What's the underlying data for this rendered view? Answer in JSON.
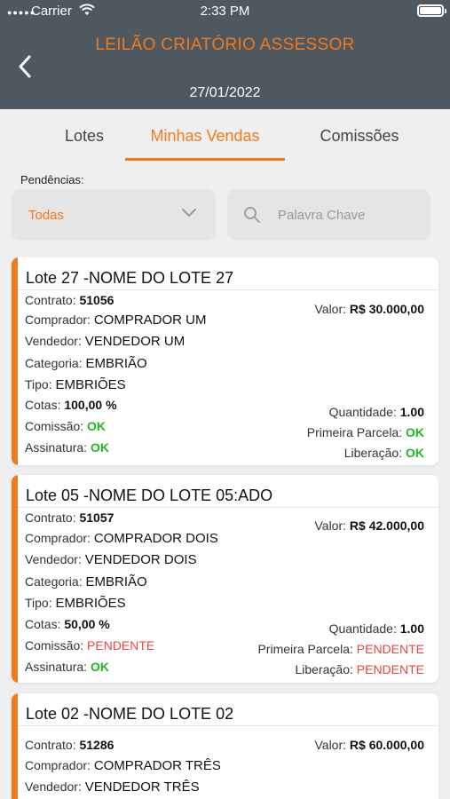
{
  "status_bar": {
    "carrier": "Carrier",
    "time": "2:33 PM"
  },
  "header": {
    "title": "LEILÃO CRIATÓRIO ASSESSOR",
    "date": "27/01/2022"
  },
  "tabs": [
    {
      "label": "Lotes"
    },
    {
      "label": "Minhas Vendas"
    },
    {
      "label": "Comissões"
    }
  ],
  "filters": {
    "label": "Pendências:",
    "selected": "Todas",
    "search_placeholder": "Palavra Chave"
  },
  "labels": {
    "contrato": "Contrato:",
    "comprador": "Comprador:",
    "vendedor": "Vendedor:",
    "categoria": "Categoria:",
    "tipo": "Tipo:",
    "cotas": "Cotas:",
    "comissao": "Comissão:",
    "assinatura": "Assinatura:",
    "valor": "Valor:",
    "quantidade": "Quantidade:",
    "primeira_parcela": "Primeira Parcela:",
    "liberacao": "Liberação:"
  },
  "lots": [
    {
      "title": "Lote 27 -NOME DO LOTE 27",
      "contrato": "51056",
      "comprador": "COMPRADOR UM",
      "vendedor": "VENDEDOR UM",
      "categoria": "EMBRIÃO",
      "tipo": "EMBRIÕES",
      "cotas": "100,00 %",
      "comissao": "OK",
      "assinatura": "OK",
      "valor": "R$ 30.000,00",
      "quantidade": "1.00",
      "primeira_parcela": "OK",
      "liberacao": "OK"
    },
    {
      "title": "Lote 05 -NOME DO LOTE 05:ADO",
      "contrato": "51057",
      "comprador": "COMPRADOR DOIS",
      "vendedor": "VENDEDOR DOIS",
      "categoria": "EMBRIÃO",
      "tipo": "EMBRIÕES",
      "cotas": "50,00 %",
      "comissao": "PENDENTE",
      "assinatura": "OK",
      "valor": "R$ 42.000,00",
      "quantidade": "1.00",
      "primeira_parcela": "PENDENTE",
      "liberacao": "PENDENTE"
    },
    {
      "title": "Lote 02 -NOME DO LOTE 02",
      "contrato": "51286",
      "comprador": "COMPRADOR TRÊS",
      "vendedor": "VENDEDOR TRÊS",
      "valor": "R$ 60.000,00"
    }
  ],
  "colors": {
    "accent": "#f07a1d",
    "header_bg": "#4d5860",
    "ok": "#1fb81f",
    "pending": "#e9473a"
  }
}
